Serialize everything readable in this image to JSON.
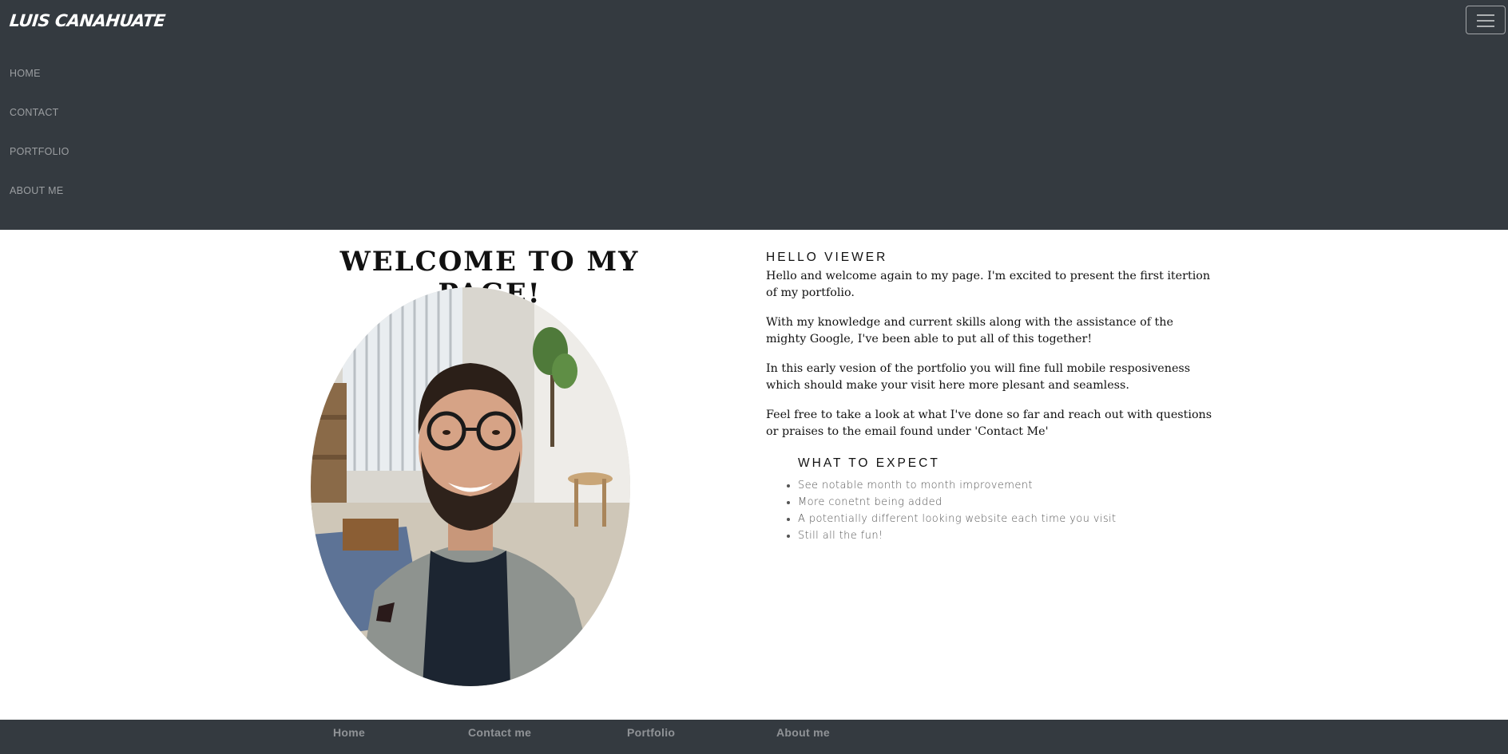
{
  "header": {
    "brand": "LUIS CANAHUATE",
    "menu_toggle_icon": "hamburger-menu-icon",
    "nav": [
      {
        "label": "HOME"
      },
      {
        "label": "CONTACT"
      },
      {
        "label": "PORTFOLIO"
      },
      {
        "label": "ABOUT ME"
      }
    ],
    "background_color": "#343a40"
  },
  "main": {
    "title": "WELCOME TO MY PAGE!",
    "intro": {
      "heading": "HELLO VIEWER",
      "paragraphs": [
        "Hello and welcome again to my page. I'm excited to present the first itertion of my portfolio.",
        "With my knowledge and current skills along with the assistance of the mighty Google, I've been able to put all of this together!",
        "In this early vesion of the portfolio you will fine full mobile resposiveness which should make your visit here more plesant and seamless.",
        "Feel free to take a look at what I've done so far and reach out with questions or praises to the email found under 'Contact Me'"
      ]
    },
    "expect": {
      "heading": "WHAT TO EXPECT",
      "items": [
        "See notable month to month improvement",
        "More conetnt being added",
        "A potentially different looking website each time you visit",
        "Still all the fun!"
      ]
    }
  },
  "footer": {
    "links": [
      {
        "label": "Home"
      },
      {
        "label": "Contact me"
      },
      {
        "label": "Portfolio"
      },
      {
        "label": "About me"
      }
    ]
  }
}
